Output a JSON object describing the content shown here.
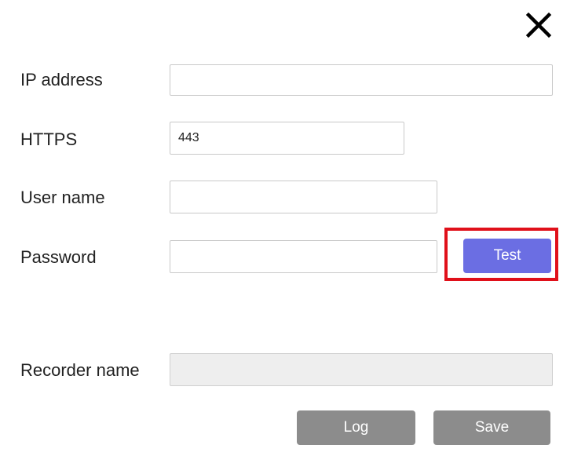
{
  "form": {
    "ip_address": {
      "label": "IP address",
      "value": ""
    },
    "https": {
      "label": "HTTPS",
      "value": "443"
    },
    "user_name": {
      "label": "User name",
      "value": ""
    },
    "password": {
      "label": "Password",
      "value": ""
    },
    "recorder_name": {
      "label": "Recorder name",
      "value": ""
    }
  },
  "buttons": {
    "test": "Test",
    "log": "Log",
    "save": "Save"
  },
  "icons": {
    "close": "close-icon"
  },
  "colors": {
    "primary": "#6b6ee3",
    "secondary": "#8c8c8c",
    "highlight": "#e0101a"
  }
}
